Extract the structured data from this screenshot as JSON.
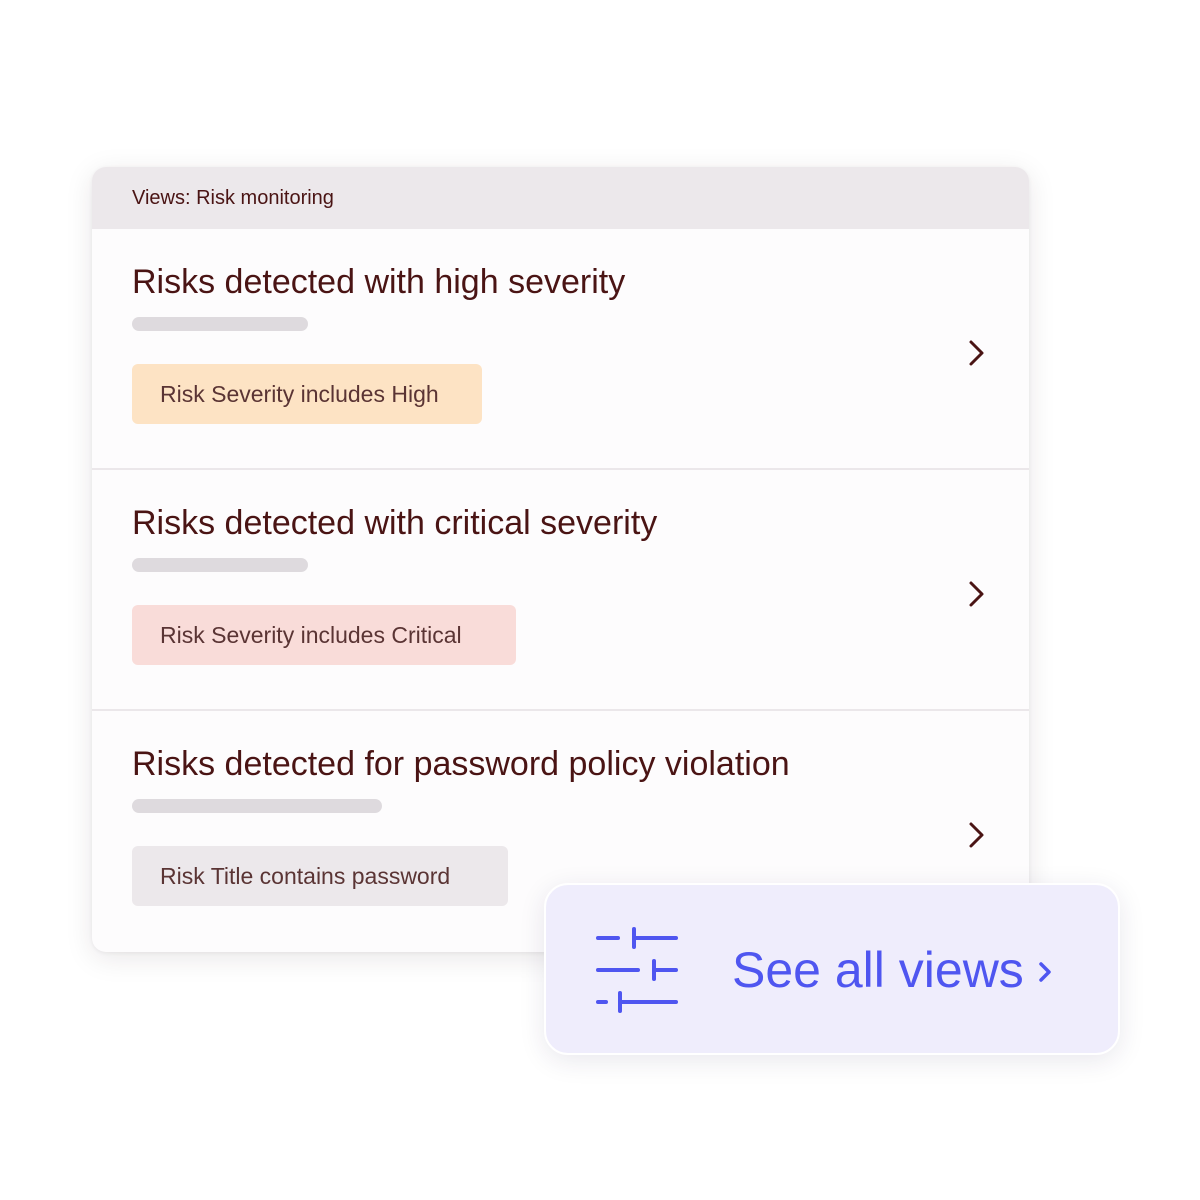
{
  "header": {
    "title": "Views: Risk monitoring"
  },
  "views": [
    {
      "title": "Risks detected with high severity",
      "filter": "Risk Severity includes High"
    },
    {
      "title": "Risks detected with critical severity",
      "filter": "Risk Severity includes Critical"
    },
    {
      "title": "Risks detected for password policy violation",
      "filter": "Risk Title contains password"
    }
  ],
  "see_all": {
    "label": "See all views"
  },
  "icons": {
    "row_arrow": "chevron-right-icon",
    "filters": "sliders-icon",
    "see_all_arrow": "chevron-right-icon"
  },
  "colors": {
    "title_text": "#4a1414",
    "chip_high": "#fde3c4",
    "chip_critical": "#f9dcd9",
    "chip_neutral": "#ece8eb",
    "accent": "#4f56f0",
    "accent_bg": "#efedfc"
  }
}
